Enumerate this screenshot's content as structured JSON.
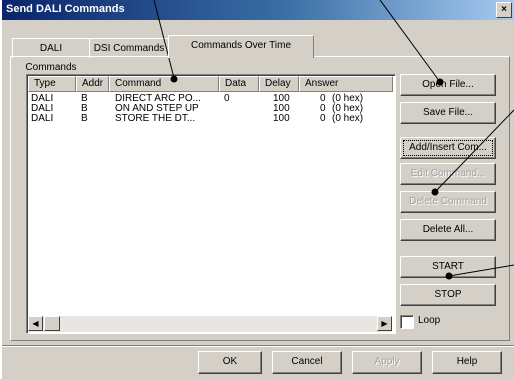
{
  "window": {
    "title": "Send DALI Commands",
    "close_glyph": "×"
  },
  "tabs": [
    {
      "label": "DALI Commands"
    },
    {
      "label": "DSI Commands"
    },
    {
      "label": "Commands Over Time"
    }
  ],
  "table": {
    "headers": [
      "Type",
      "Addr",
      "Command",
      "Data",
      "Delay",
      "Answer"
    ],
    "rows": [
      {
        "type": "DALI",
        "addr": "B",
        "command": "DIRECT ARC PO...",
        "data": "0",
        "delay": "100",
        "answer_val": "0",
        "answer_hex": "(0 hex)"
      },
      {
        "type": "DALI",
        "addr": "B",
        "command": "ON AND STEP UP",
        "data": "",
        "delay": "100",
        "answer_val": "0",
        "answer_hex": "(0 hex)"
      },
      {
        "type": "DALI",
        "addr": "B",
        "command": "STORE THE DT...",
        "data": "",
        "delay": "100",
        "answer_val": "0",
        "answer_hex": "(0 hex)"
      }
    ],
    "scroll_left_glyph": "◀",
    "scroll_right_glyph": "▶"
  },
  "side_buttons": {
    "open_file": "Open File...",
    "save_file": "Save File...",
    "add_insert": "Add/Insert Com...",
    "edit_command": "Edit Command...",
    "delete_command": "Delete Command",
    "delete_all": "Delete All...",
    "start": "START",
    "stop": "STOP"
  },
  "loop_label": "Loop",
  "bottom_buttons": {
    "ok": "OK",
    "cancel": "Cancel",
    "apply": "Apply",
    "help": "Help"
  },
  "icons": {
    "close": "close-icon",
    "scroll_left": "arrow-left-icon",
    "scroll_right": "arrow-right-icon"
  }
}
